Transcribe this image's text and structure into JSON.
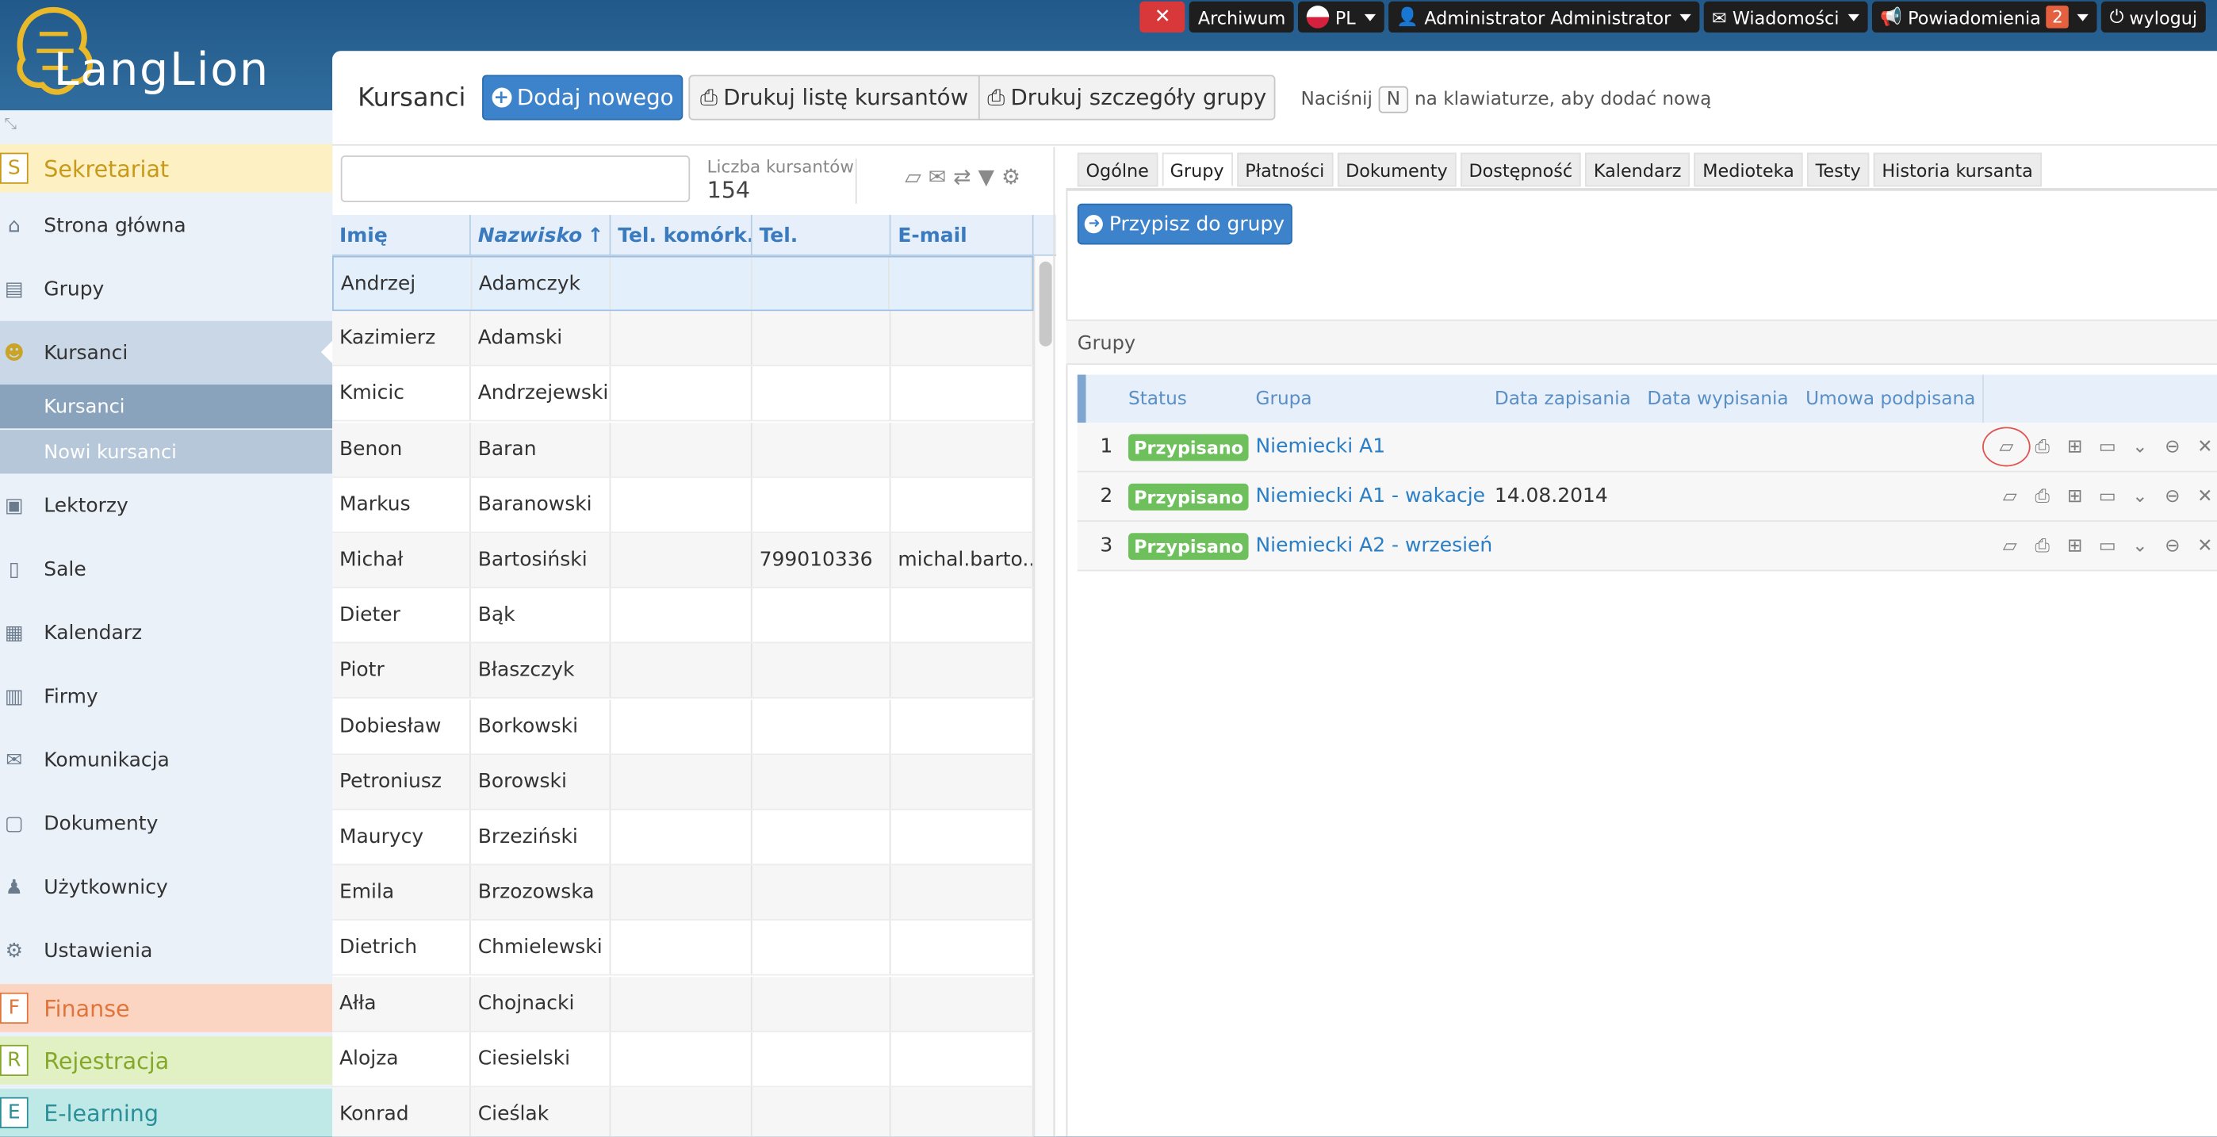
{
  "topbar": {
    "archive": "Archiwum",
    "lang": "PL",
    "user": "Administrator Administrator",
    "messages": "Wiadomości",
    "notifications": "Powiadomienia",
    "notif_count": "2",
    "logout": "wyloguj"
  },
  "logo": {
    "text": "LangLion"
  },
  "sidebar": {
    "sections": {
      "sekretariat": {
        "letter": "S",
        "label": "Sekretariat"
      },
      "finanse": {
        "letter": "F",
        "label": "Finanse"
      },
      "rejestracja": {
        "letter": "R",
        "label": "Rejestracja"
      },
      "elearning": {
        "letter": "E",
        "label": "E-learning"
      }
    },
    "items": [
      "Strona główna",
      "Grupy",
      "Kursanci",
      "Lektorzy",
      "Sale",
      "Kalendarz",
      "Firmy",
      "Komunikacja",
      "Dokumenty",
      "Użytkownicy",
      "Ustawienia"
    ],
    "subitems": [
      "Kursanci",
      "Nowi kursanci"
    ]
  },
  "header": {
    "title": "Kursanci",
    "add": "Dodaj nowego",
    "print_list": "Drukuj listę kursantów",
    "print_group": "Drukuj szczegóły grupy",
    "hint_pre": "Naciśnij",
    "hint_key": "N",
    "hint_post": "na klawiaturze, aby dodać nową"
  },
  "search": {
    "value": "",
    "count_label": "Liczba kursantów",
    "count": "154"
  },
  "grid": {
    "columns": [
      "Imię",
      "Nazwisko",
      "Tel. komórk...",
      "Tel.",
      "E-mail"
    ],
    "rows": [
      [
        "Andrzej",
        "Adamczyk",
        "",
        "",
        ""
      ],
      [
        "Kazimierz",
        "Adamski",
        "",
        "",
        ""
      ],
      [
        "Kmicic",
        "Andrzejewski",
        "",
        "",
        ""
      ],
      [
        "Benon",
        "Baran",
        "",
        "",
        ""
      ],
      [
        "Markus",
        "Baranowski",
        "",
        "",
        ""
      ],
      [
        "Michał",
        "Bartosiński",
        "",
        "799010336",
        "michal.barto..."
      ],
      [
        "Dieter",
        "Bąk",
        "",
        "",
        ""
      ],
      [
        "Piotr",
        "Błaszczyk",
        "",
        "",
        ""
      ],
      [
        "Dobiesław",
        "Borkowski",
        "",
        "",
        ""
      ],
      [
        "Petroniusz",
        "Borowski",
        "",
        "",
        ""
      ],
      [
        "Maurycy",
        "Brzeziński",
        "",
        "",
        ""
      ],
      [
        "Emila",
        "Brzozowska",
        "",
        "",
        ""
      ],
      [
        "Dietrich",
        "Chmielewski",
        "",
        "",
        ""
      ],
      [
        "Ałła",
        "Chojnacki",
        "",
        "",
        ""
      ],
      [
        "Alojza",
        "Ciesielski",
        "",
        "",
        ""
      ],
      [
        "Konrad",
        "Cieślak",
        "",
        "",
        ""
      ]
    ]
  },
  "tabs": [
    "Ogólne",
    "Grupy",
    "Płatności",
    "Dokumenty",
    "Dostępność",
    "Kalendarz",
    "Medioteka",
    "Testy",
    "Historia kursanta"
  ],
  "assign_button": "Przypisz do grupy",
  "groups": {
    "section_title": "Grupy",
    "columns": [
      "Status",
      "Grupa",
      "Data zapisania",
      "Data wypisania",
      "Umowa podpisana"
    ],
    "rows": [
      {
        "n": "1",
        "status": "Przypisano",
        "group": "Niemiecki A1",
        "enrolled": "",
        "left": "",
        "contract": ""
      },
      {
        "n": "2",
        "status": "Przypisano",
        "group": "Niemiecki A1 - wakacje",
        "enrolled": "14.08.2014",
        "left": "",
        "contract": ""
      },
      {
        "n": "3",
        "status": "Przypisano",
        "group": "Niemiecki A2 - wrzesień",
        "enrolled": "",
        "left": "",
        "contract": ""
      }
    ]
  },
  "colors": {
    "accent": "#3c83cb",
    "label_green": "#6ec05c",
    "highlight_ring": "#e0524f"
  }
}
